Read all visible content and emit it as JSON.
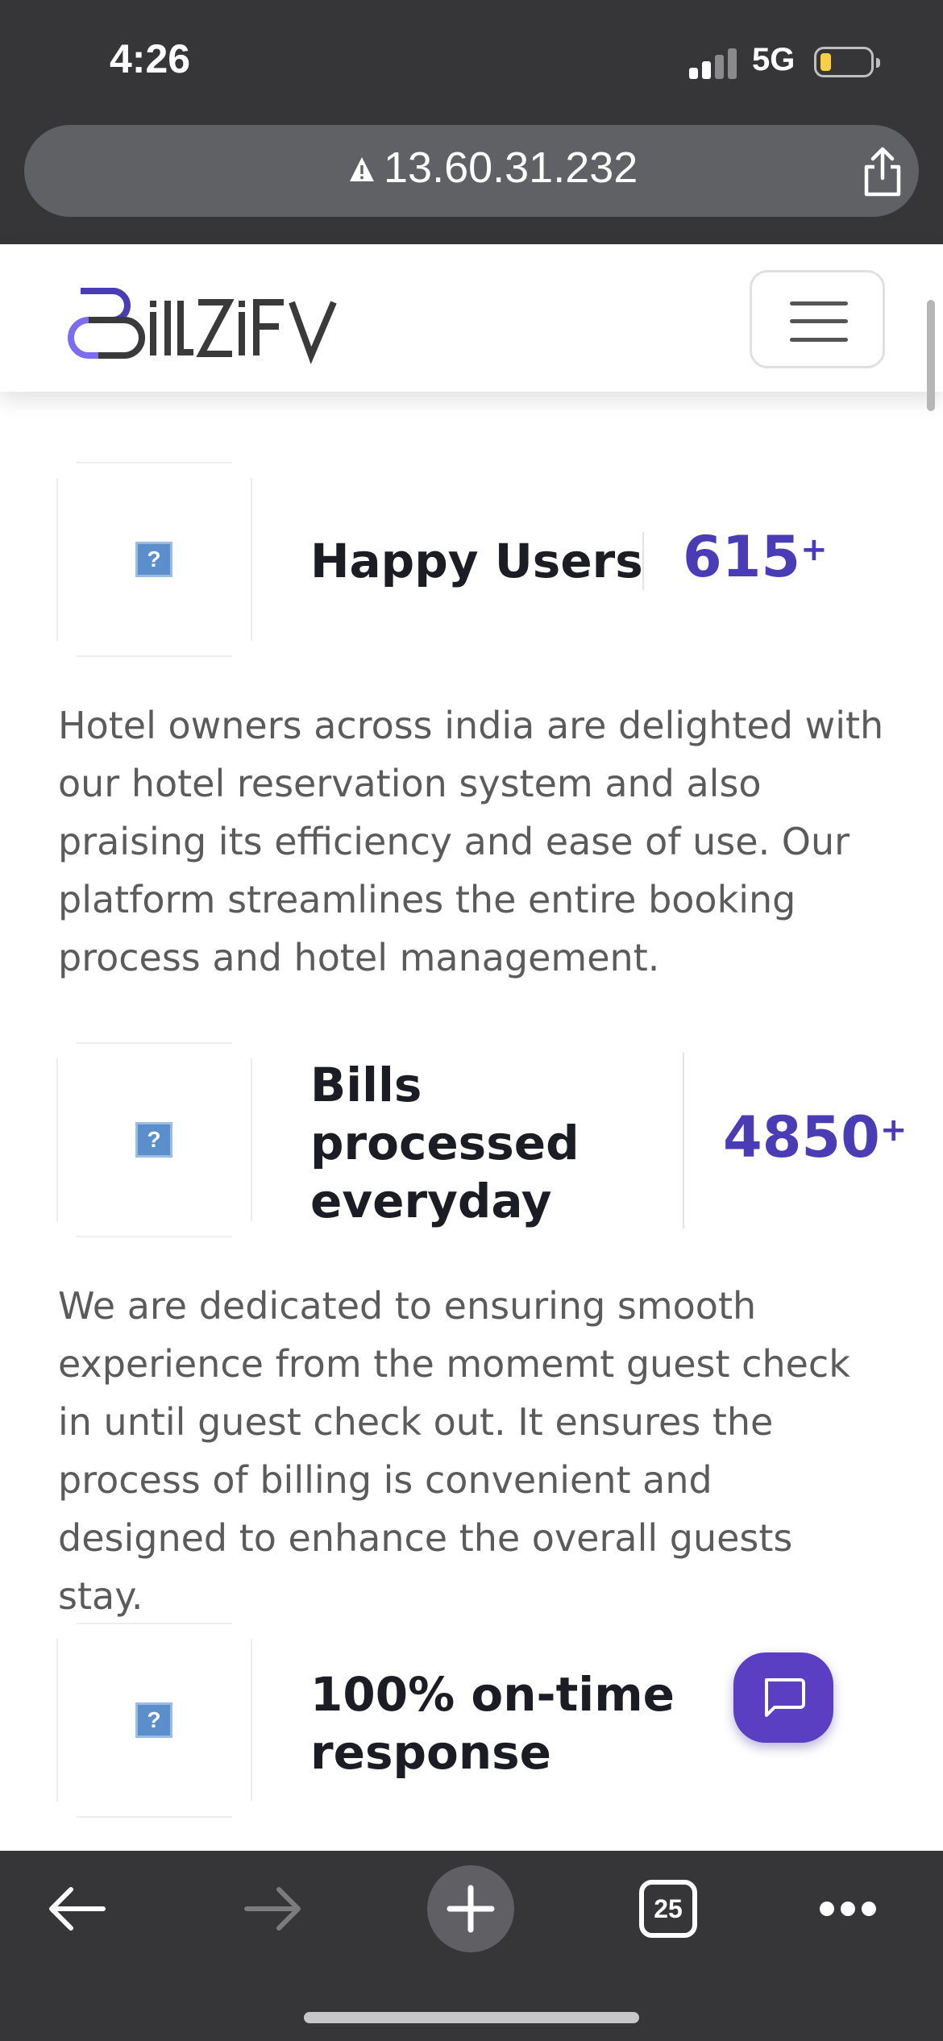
{
  "status_bar": {
    "time": "4:26",
    "network": "5G"
  },
  "browser": {
    "url": "13.60.31.232",
    "tab_count": "25"
  },
  "site": {
    "logo_text": "BillZifY",
    "colors": {
      "brand": "#4a3cb4",
      "logo_accent": "#7b6cf0"
    }
  },
  "stats": [
    {
      "title": "Happy Users",
      "value": "615",
      "suffix": "+",
      "description": "Hotel owners across india are delighted with our hotel reservation system and also praising its efficiency and ease of use. Our platform streamlines the entire booking process and hotel management."
    },
    {
      "title": "Bills processed everyday",
      "value": "4850",
      "suffix": "+",
      "description": "We are dedicated to ensuring smooth experience from the momemt guest check in until guest check out. It ensures the process of billing is convenient and designed to enhance the overall guests stay."
    },
    {
      "title": "100% on-time response"
    }
  ],
  "icons": {
    "stat_image": "?"
  }
}
